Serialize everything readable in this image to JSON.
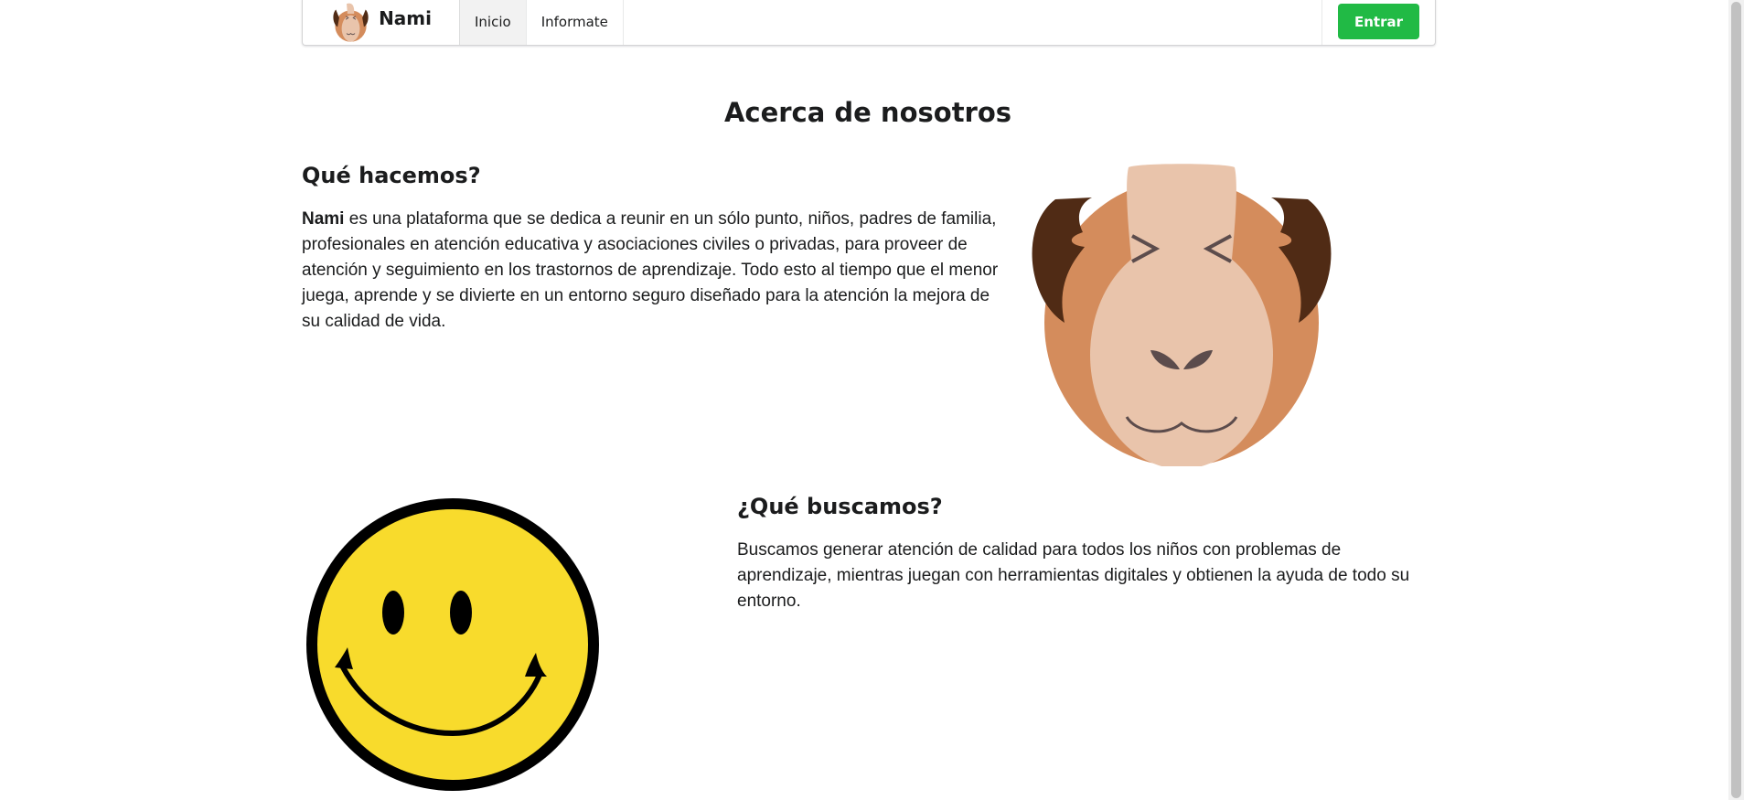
{
  "navbar": {
    "brand_name": "Nami",
    "items": [
      {
        "label": "Inicio",
        "active": true
      },
      {
        "label": "Informate",
        "active": false
      }
    ],
    "login_label": "Entrar"
  },
  "about": {
    "title": "Acerca de nosotros",
    "what_we_do": {
      "heading": "Qué hacemos?",
      "bold_lead": "Nami",
      "text": " es una plataforma que se dedica a reunir en un sólo punto, niños, padres de familia, profesionales en atención educativa y asociaciones civiles o privadas, para proveer de atención y seguimiento en los trastornos de aprendizaje. Todo esto al tiempo que el menor juega, aprende y se divierte en un entorno seguro diseñado para la atención la mejora de su calidad de vida."
    },
    "what_we_seek": {
      "heading": "¿Qué buscamos?",
      "text": "Buscamos generar atención de calidad para todos los niños con problemas de aprendizaje, mientras juegan con herramientas digitales y obtienen la ayuda de todo su entorno."
    }
  },
  "colors": {
    "accent_green": "#21ba45",
    "guinea_brown": "#d48c5c",
    "guinea_cream": "#e9c4ab",
    "guinea_dark": "#502b15",
    "smiley_yellow": "#f8db2c"
  },
  "icons": {
    "brand_logo": "guinea-pig-logo-icon",
    "about_image": "guinea-pig-face-icon",
    "seek_image": "smiley-face-icon"
  }
}
